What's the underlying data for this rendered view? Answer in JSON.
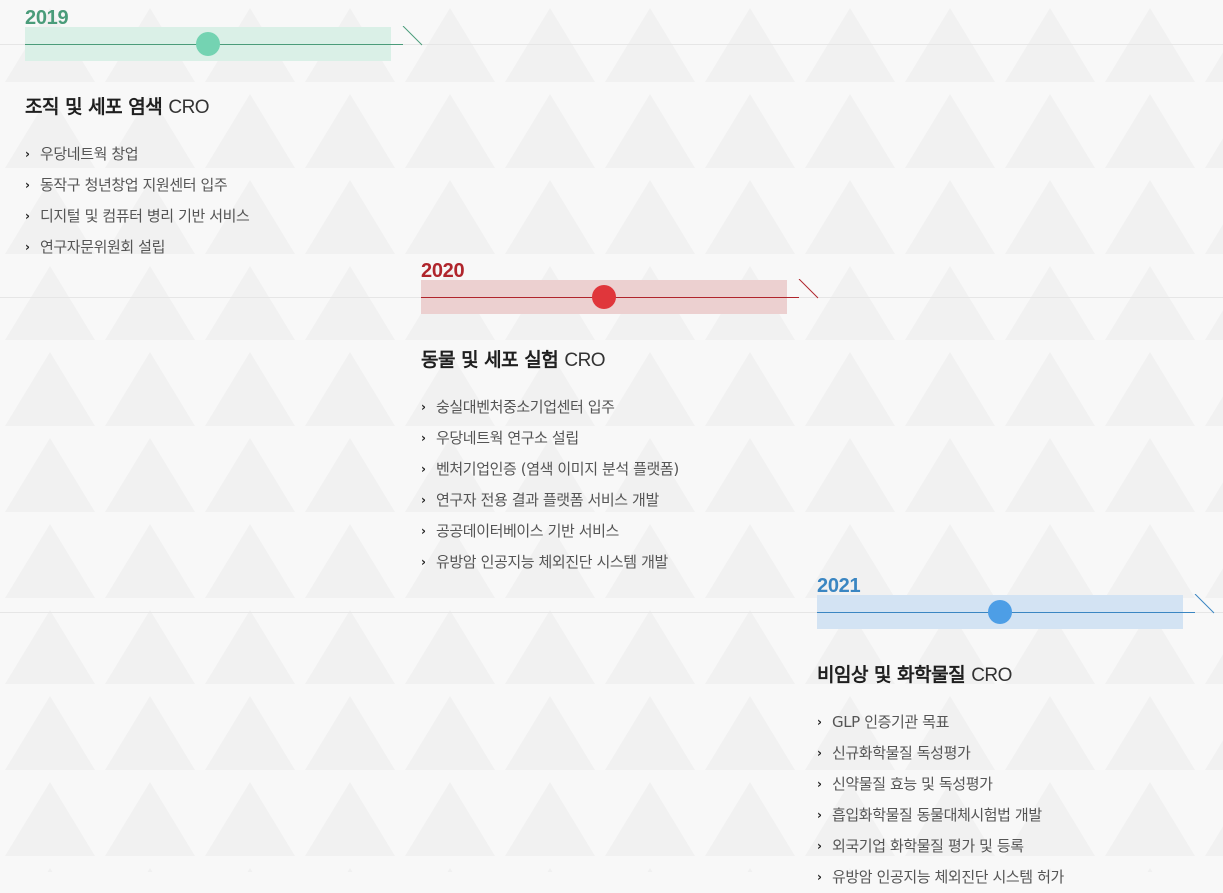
{
  "timeline": [
    {
      "year": "2019",
      "accent": "#4a9c7a",
      "band": "#daf0e7",
      "dot": "#74d3b2",
      "title_ko": "조직 및 세포 염색",
      "title_en": "CRO",
      "items": [
        "우당네트웍 창업",
        "동작구 청년창업 지원센터 입주",
        "디지털 및 컴퓨터 병리 기반 서비스",
        "연구자문위원회 설립"
      ]
    },
    {
      "year": "2020",
      "accent": "#b0252c",
      "band": "#ecd0d0",
      "dot": "#e0363b",
      "title_ko": "동물 및 세포 실험",
      "title_en": "CRO",
      "items": [
        "숭실대벤처중소기업센터 입주",
        "우당네트웍 연구소 설립",
        "벤처기업인증 (염색 이미지 분석 플랫폼)",
        "연구자 전용 결과 플랫폼 서비스 개발",
        "공공데이터베이스 기반 서비스",
        "유방암 인공지능 체외진단 시스템 개발"
      ]
    },
    {
      "year": "2021",
      "accent": "#3a86c2",
      "band": "#d3e3f3",
      "dot": "#4d9ee6",
      "title_ko": "비임상 및 화학물질",
      "title_en": "CRO",
      "items": [
        "GLP 인증기관 목표",
        "신규화학물질 독성평가",
        "신약물질 효능 및 독성평가",
        "흡입화학물질 동물대체시험법 개발",
        "외국기업 화학물질 평가 및 등록",
        "유방암 인공지능 체외진단 시스템 허가"
      ]
    }
  ],
  "icons": {
    "bullet": "chevron-right-icon",
    "year_marker": "timeline-dot-icon"
  },
  "bullet_glyph": "›"
}
